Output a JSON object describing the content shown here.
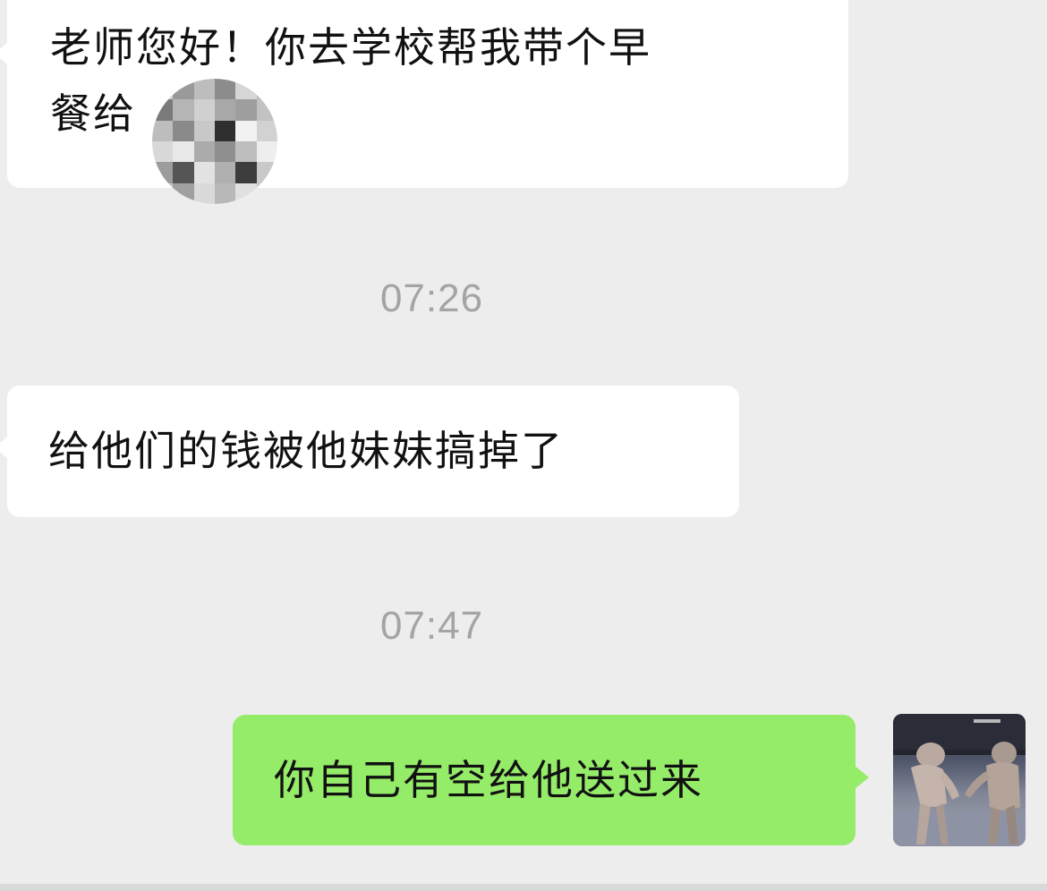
{
  "chat": {
    "messages": [
      {
        "direction": "incoming",
        "text_line1": "老师您好！你去学校帮我带个早",
        "text_line2": "餐给"
      },
      {
        "direction": "incoming",
        "text": "给他们的钱被他妹妹搞掉了"
      },
      {
        "direction": "outgoing",
        "text": "你自己有空给他送过来"
      }
    ],
    "timestamps": [
      "07:26",
      "07:47"
    ]
  },
  "colors": {
    "background": "#ededed",
    "incoming_bubble": "#ffffff",
    "outgoing_bubble": "#95ec69",
    "timestamp_text": "#a4a4a4"
  },
  "icons": {
    "sender_avatar": "avatar-photo-icon",
    "redaction": "pixelated-mosaic"
  }
}
